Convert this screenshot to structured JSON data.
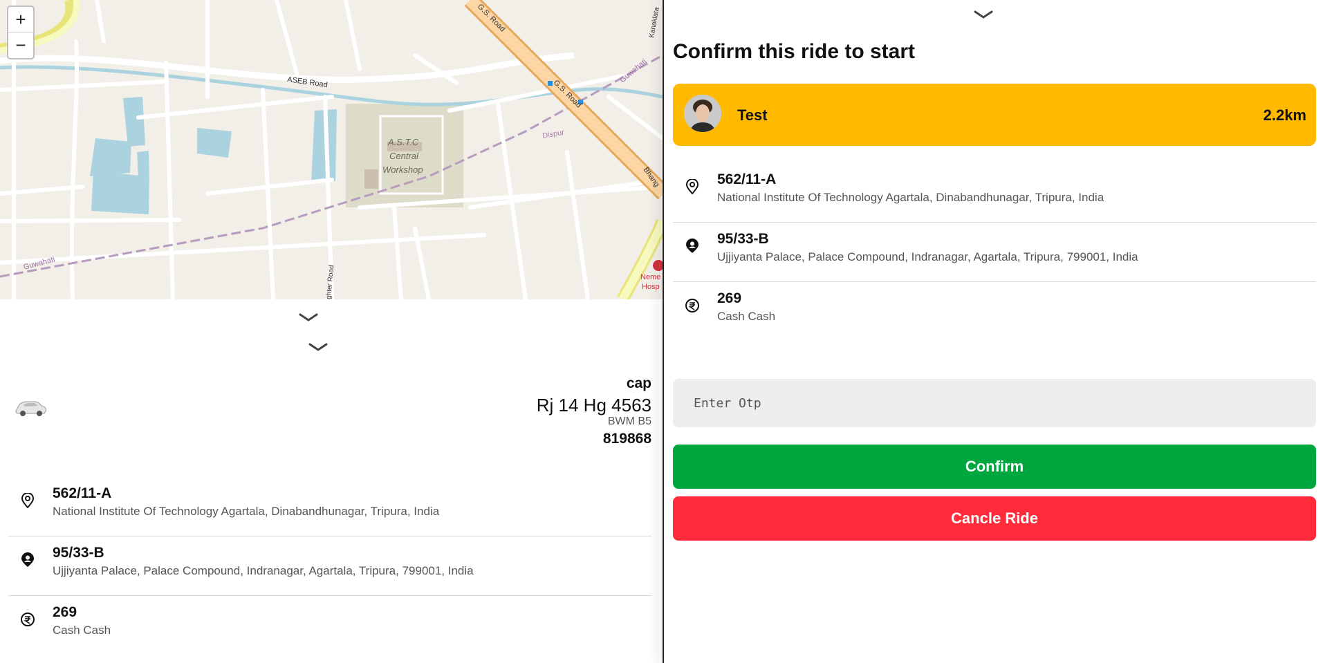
{
  "map": {
    "zoom_in": "+",
    "zoom_out": "−",
    "labels": {
      "gs_road_1": "G.S. Road",
      "gs_road_2": "G.S. Road",
      "aseb_road": "ASEB Road",
      "astc_1": "A.S.T.C",
      "astc_2": "Central",
      "astc_3": "Workshop",
      "dispur": "Dispur",
      "guwahati_left": "Guwahati",
      "guwahati_right": "Guwahati",
      "bhangagarh": "Bhang",
      "kanaklata": "Kanaklata",
      "fighter_road": "ghter Road",
      "hospital_1": "Neme",
      "hospital_2": "Hosp"
    }
  },
  "captain": {
    "name": "cap",
    "plate": "Rj 14 Hg 4563",
    "model": "BWM B5",
    "otp": "819868"
  },
  "ride": {
    "pickup": {
      "title": "562/11-A",
      "address": "National Institute Of Technology Agartala, Dinabandhunagar, Tripura, India"
    },
    "destination": {
      "title": "95/33-B",
      "address": "Ujjiyanta Palace, Palace Compound, Indranagar, Agartala, Tripura, 799001, India"
    },
    "fare": {
      "amount": "269",
      "method": "Cash Cash"
    }
  },
  "panel": {
    "title": "Confirm this ride to start",
    "rider_name": "Test",
    "distance": "2.2km",
    "otp_placeholder": "Enter Otp",
    "confirm_label": "Confirm",
    "cancel_label": "Cancle Ride"
  },
  "icons": {
    "pickup": "map-pin-icon",
    "destination": "user-location-icon",
    "fare": "rupee-icon",
    "collapse": "chevron-down-icon",
    "vehicle": "car-icon"
  },
  "colors": {
    "rider_card": "#ffba00",
    "confirm": "#00a63e",
    "cancel": "#ff2a3a",
    "input_bg": "#eeeeee"
  }
}
